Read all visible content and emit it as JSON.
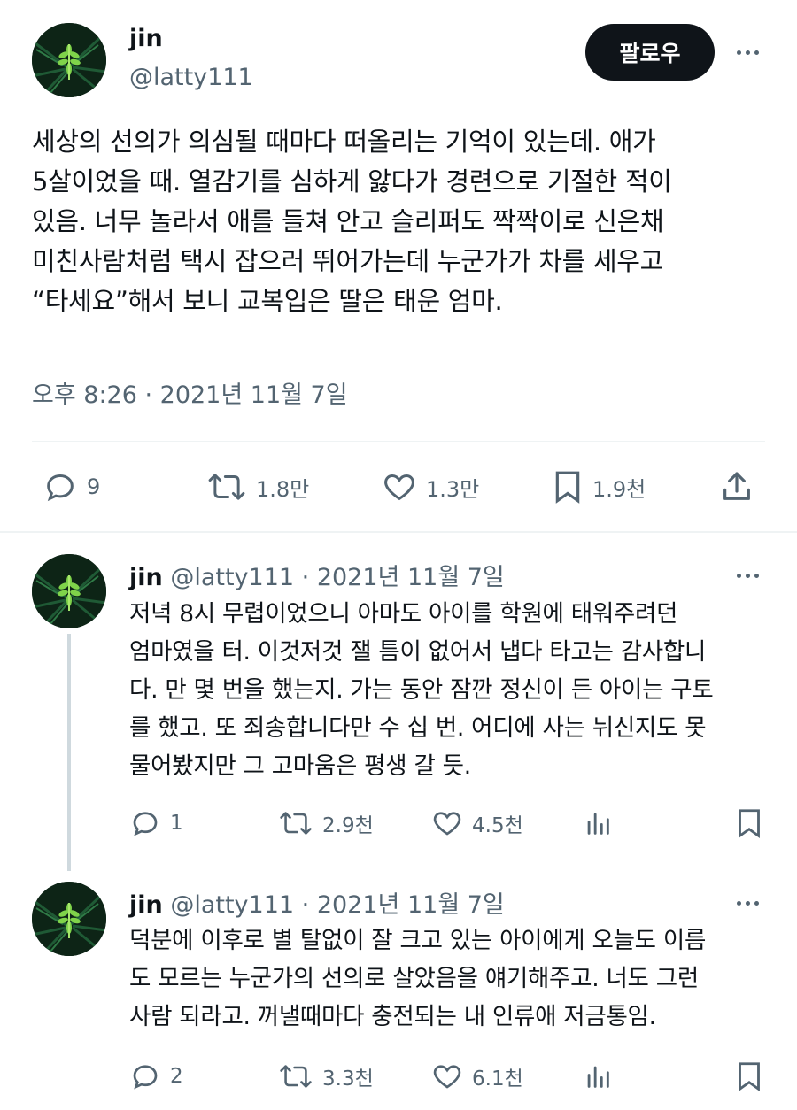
{
  "colors": {
    "text": "#0f1419",
    "muted": "#536471",
    "divider": "#eff3f4",
    "thread_line": "#cfd9de",
    "button_bg": "#0f1419",
    "button_text": "#ffffff"
  },
  "main_tweet": {
    "author": {
      "display_name": "jin",
      "handle": "@latty111",
      "avatar_icon": "fern-avatar"
    },
    "follow_label": "팔로우",
    "text": "세상의 선의가 의심될 때마다 떠올리는 기억이 있는데. 애가\n5살이었을 때. 열감기를 심하게 앓다가 경련으로 기절한 적이\n있음. 너무 놀라서 애를 들쳐 안고 슬리퍼도 짝짝이로 신은채\n미친사람처럼 택시 잡으러 뛰어가는데 누군가가 차를 세우고\n“타세요”해서 보니 교복입은 딸은 태운 엄마.",
    "timestamp": "오후 8:26 · 2021년 11월 7일",
    "actions": {
      "replies": "9",
      "retweets": "1.8만",
      "likes": "1.3만",
      "bookmarks": "1.9천",
      "share_icon": "share-icon"
    }
  },
  "replies": [
    {
      "display_name": "jin",
      "handle": "@latty111",
      "date": "· 2021년 11월 7일",
      "text": "저녁 8시 무렵이었으니 아마도 아이를 학원에 태워주려던\n엄마였을 터. 이것저것 잴 틈이 없어서 냅다 타고는 감사합니\n다. 만 몇 번을 했는지. 가는 동안 잠깐 정신이 든 아이는 구토\n를 했고. 또 죄송합니다만 수 십 번. 어디에 사는 뉘신지도 못\n물어봤지만 그 고마움은 평생 갈 듯.",
      "actions": {
        "replies": "1",
        "retweets": "2.9천",
        "likes": "4.5천"
      }
    },
    {
      "display_name": "jin",
      "handle": "@latty111",
      "date": "· 2021년 11월 7일",
      "text": "덕분에 이후로 별 탈없이 잘 크고 있는 아이에게 오늘도 이름\n도 모르는 누군가의 선의로 살았음을 얘기해주고. 너도 그런\n사람 되라고. 꺼낼때마다 충전되는 내 인류애 저금통임.",
      "actions": {
        "replies": "2",
        "retweets": "3.3천",
        "likes": "6.1천"
      }
    }
  ]
}
